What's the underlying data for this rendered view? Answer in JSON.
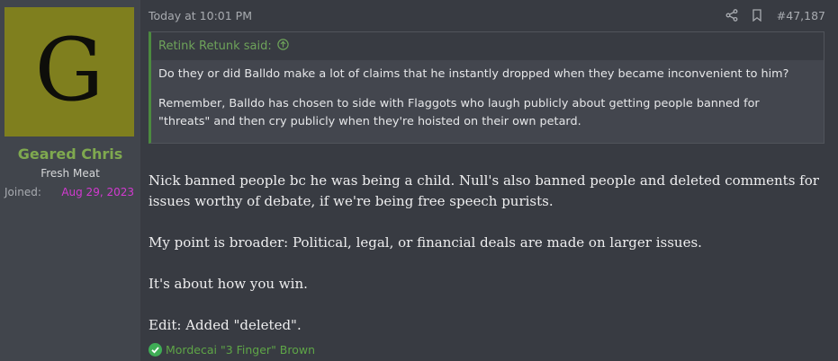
{
  "user": {
    "avatar_letter": "G",
    "avatar_color": "#7f7f1e",
    "name": "Geared Chris",
    "title": "Fresh Meat",
    "joined_label": "Joined:",
    "joined_date": "Aug 29, 2023"
  },
  "post": {
    "date": "Today at 10:01 PM",
    "number": "#47,187",
    "share_icon": "share-icon",
    "bookmark_icon": "bookmark-icon",
    "quote": {
      "author": "Retink Retunk said:",
      "arrow_icon": "arrow-up-circle-icon",
      "paragraphs": [
        "Do they or did Balldo make a lot of claims that he instantly dropped when they became inconvenient to him?",
        "Remember, Balldo has chosen to side with Flaggots who laugh publicly about getting people banned for \"threats\" and then cry publicly when they're hoisted on their own petard."
      ]
    },
    "body": [
      "Nick banned people bc he was being a child. Null's also banned people and deleted comments for issues worthy of debate, if we're being free speech purists.",
      "My point is broader: Political, legal, or financial deals are made on larger issues.",
      "It's about how you win.",
      "Edit: Added \"deleted\"."
    ],
    "reaction": {
      "icon": "check-circle-icon",
      "users": "Mordecai \"3 Finger\" Brown"
    }
  },
  "colors": {
    "accent_green": "#7fa94f",
    "joined_date": "#d23ad0",
    "quote_border": "#4c8a3f"
  }
}
